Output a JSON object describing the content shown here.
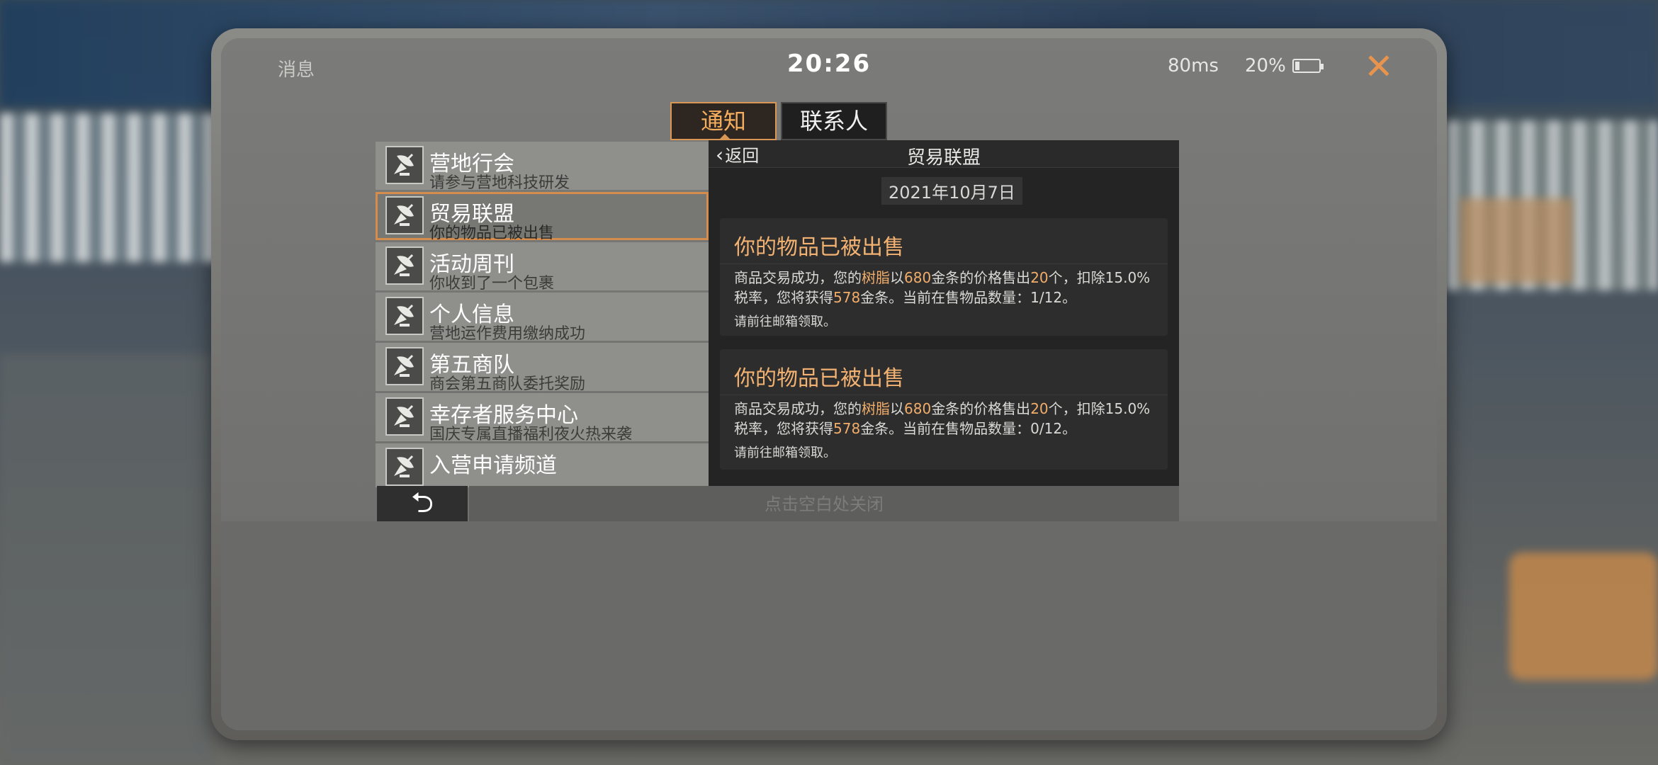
{
  "status": {
    "left_label": "消息",
    "time": "20:26",
    "ping": "80ms",
    "battery": "20%",
    "battery_level": 0.2,
    "close_icon": "close-x-icon"
  },
  "tabs": [
    {
      "label": "通知",
      "active": true
    },
    {
      "label": "联系人",
      "active": false
    }
  ],
  "list": [
    {
      "title": "营地行会",
      "subtitle": "请参与营地科技研发",
      "icon": "satellite-dish-icon"
    },
    {
      "title": "贸易联盟",
      "subtitle": "你的物品已被出售",
      "icon": "satellite-dish-icon",
      "selected": true
    },
    {
      "title": "活动周刊",
      "subtitle": "你收到了一个包裹",
      "icon": "satellite-dish-icon"
    },
    {
      "title": "个人信息",
      "subtitle": "营地运作费用缴纳成功",
      "icon": "satellite-dish-icon"
    },
    {
      "title": "第五商队",
      "subtitle": "商会第五商队委托奖励",
      "icon": "satellite-dish-icon"
    },
    {
      "title": "幸存者服务中心",
      "subtitle": "国庆专属直播福利夜火热来袭",
      "icon": "satellite-dish-icon"
    },
    {
      "title": "入营申请频道",
      "subtitle": "",
      "icon": "satellite-dish-icon"
    }
  ],
  "detail": {
    "back_label": "返回",
    "title": "贸易联盟",
    "date": "2021年10月7日",
    "messages": [
      {
        "title": "你的物品已被出售",
        "body_parts": {
          "p1": "商品交易成功，您的",
          "item": "树脂",
          "p2": "以",
          "price": "680",
          "p3": "金条的价格售出",
          "qty": "20",
          "p4": "个，扣除15.0%税率，您将获得",
          "earned": "578",
          "p5": "金条。当前在售物品数量：1/12。"
        },
        "note": "请前往邮箱领取。"
      },
      {
        "title": "你的物品已被出售",
        "body_parts": {
          "p1": "商品交易成功，您的",
          "item": "树脂",
          "p2": "以",
          "price": "680",
          "p3": "金条的价格售出",
          "qty": "20",
          "p4": "个，扣除15.0%税率，您将获得",
          "earned": "578",
          "p5": "金条。当前在售物品数量：0/12。"
        },
        "note": "请前往邮箱领取。"
      }
    ]
  },
  "bottom": {
    "back_icon": "undo-arrow-icon",
    "close_hint": "点击空白处关闭"
  },
  "colors": {
    "accent": "#f2ad6a",
    "tab_border": "#d99654",
    "close": "#e8944c"
  }
}
